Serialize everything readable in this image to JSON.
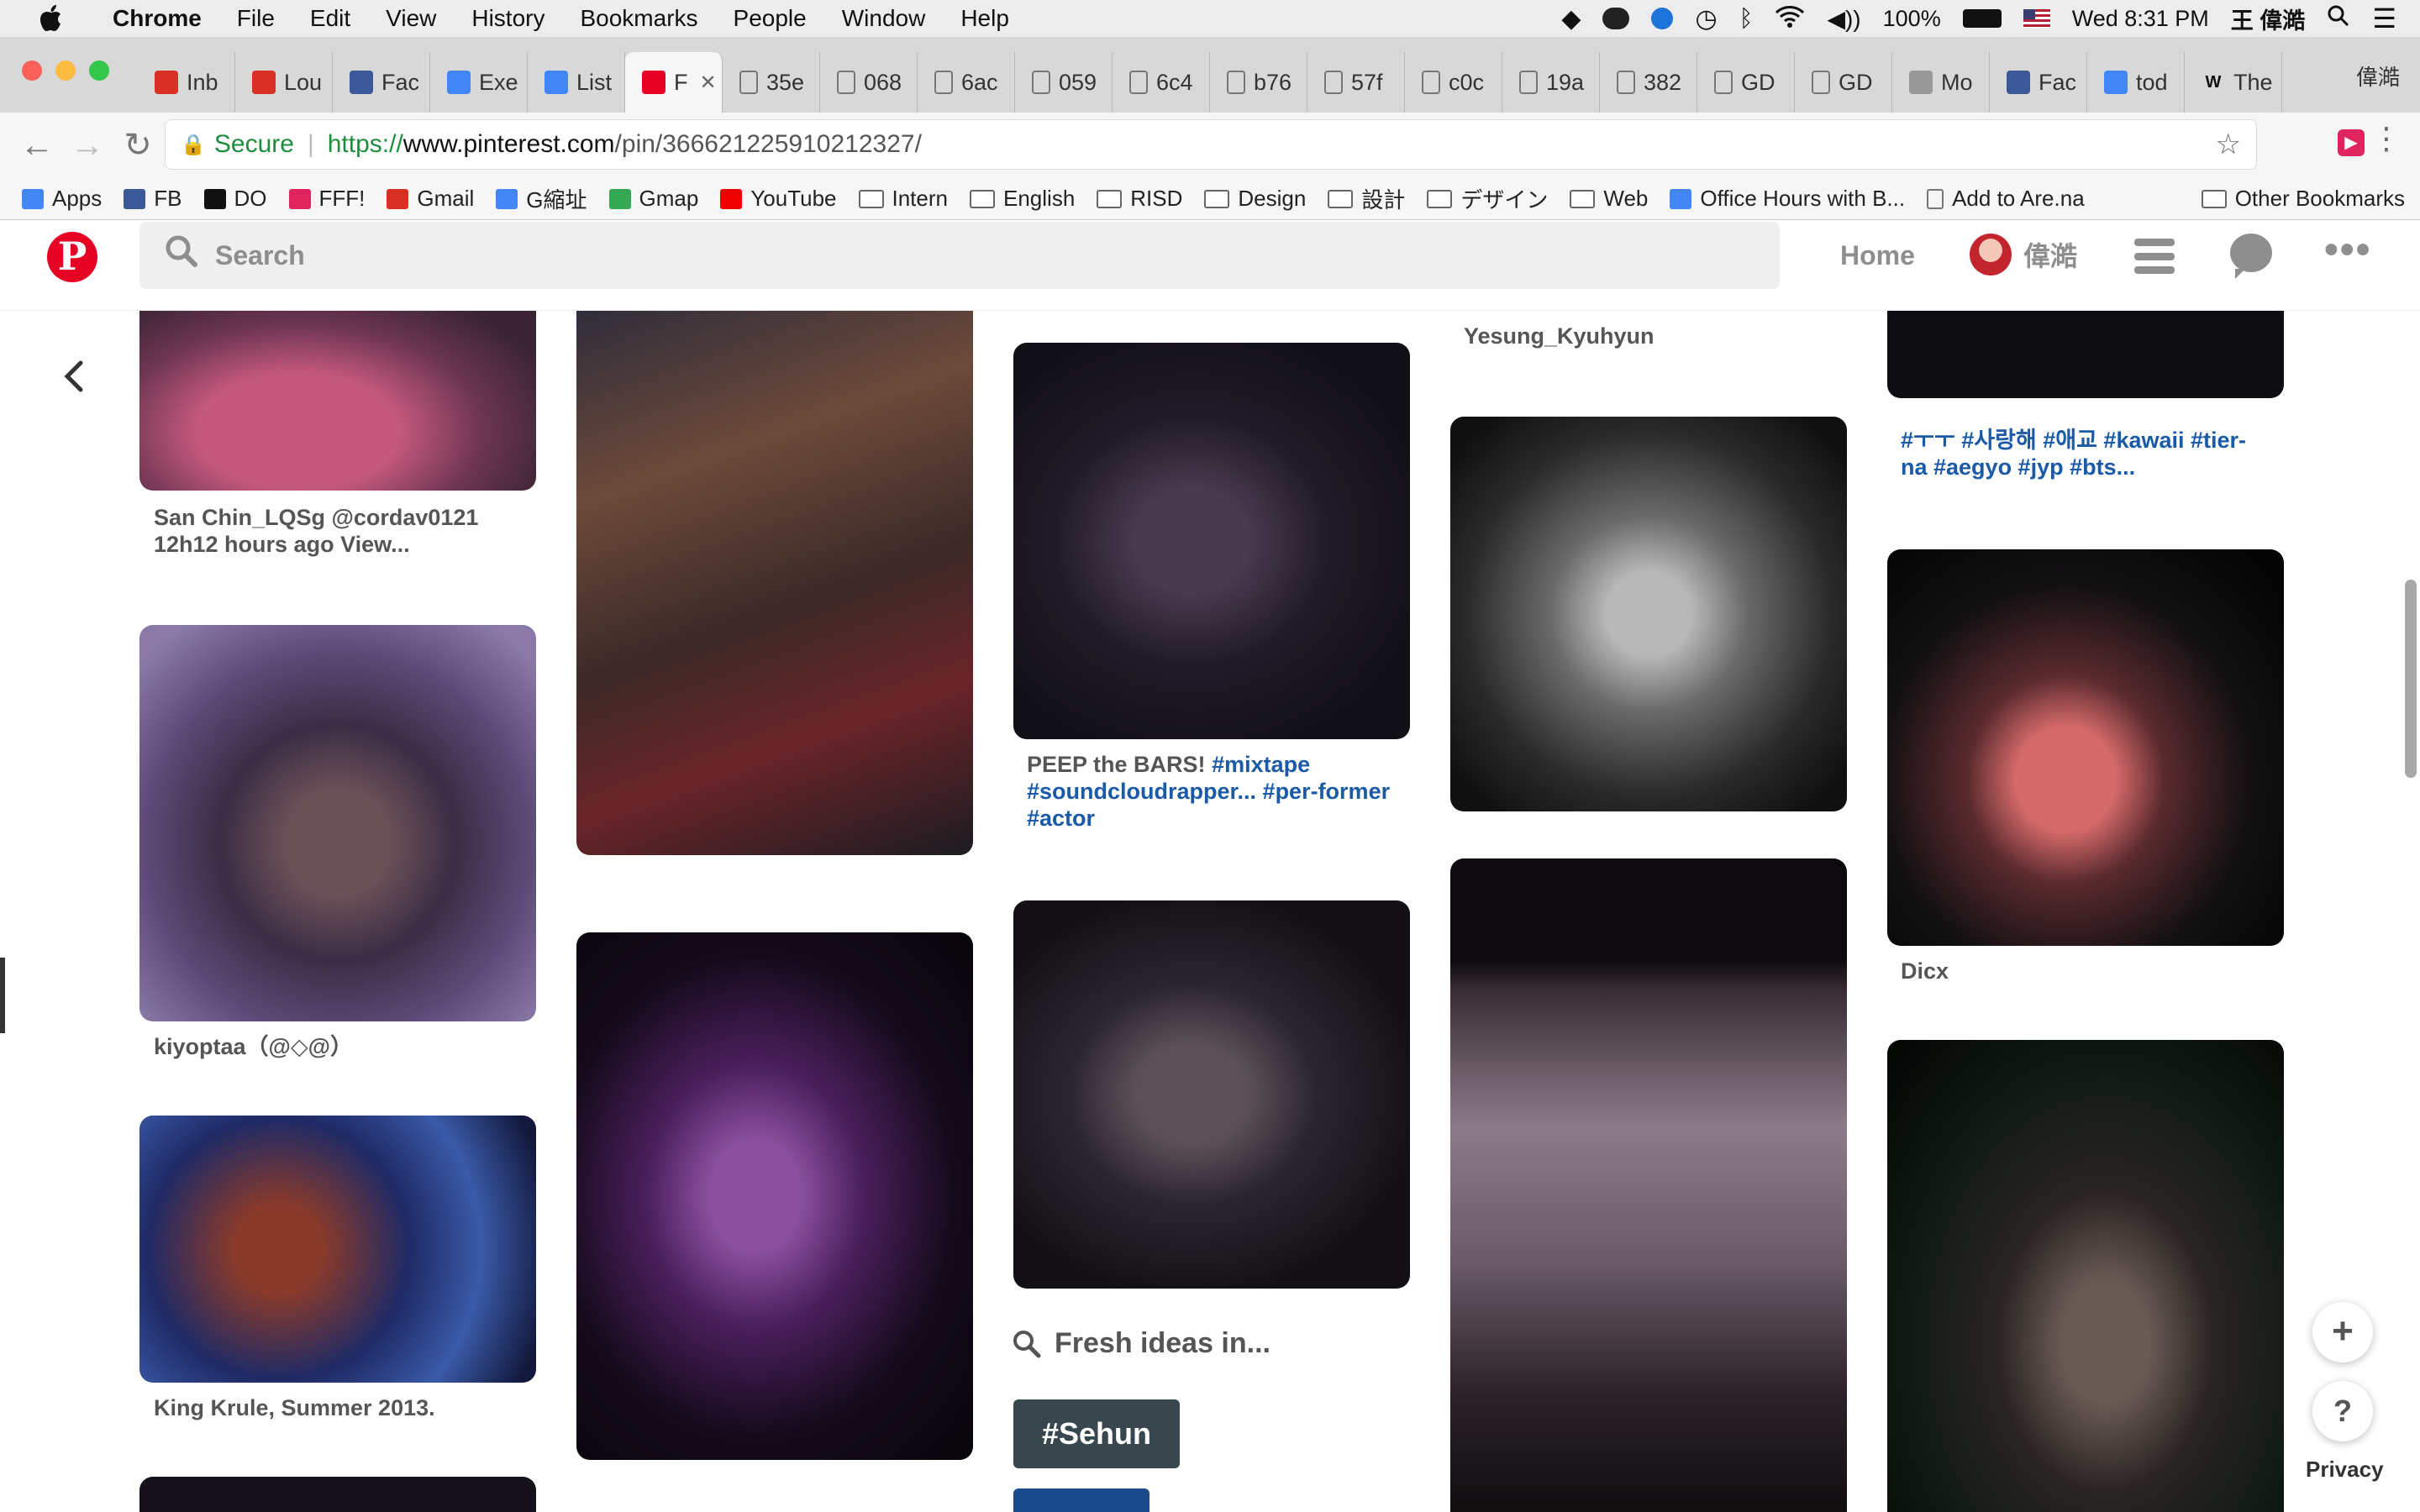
{
  "menubar": {
    "app": "Chrome",
    "items": [
      "File",
      "Edit",
      "View",
      "History",
      "Bookmarks",
      "People",
      "Window",
      "Help"
    ],
    "battery": "100%",
    "datetime": "Wed 8:31 PM",
    "user": "王 偉澔"
  },
  "tabs": [
    {
      "label": "Inb",
      "icon": "gmail-icon",
      "color": "#d93025"
    },
    {
      "label": "Lou",
      "icon": "gmail-icon",
      "color": "#d93025"
    },
    {
      "label": "Fac",
      "icon": "facebook-icon",
      "color": "#3b5998"
    },
    {
      "label": "Exe",
      "icon": "docs-icon",
      "color": "#4285f4"
    },
    {
      "label": "List",
      "icon": "docs-icon",
      "color": "#4285f4"
    },
    {
      "label": "F",
      "icon": "pinterest-icon",
      "color": "#e60023",
      "active": true
    },
    {
      "label": "35e",
      "icon": "file-icon",
      "color": "#888"
    },
    {
      "label": "068",
      "icon": "file-icon",
      "color": "#888"
    },
    {
      "label": "6ac",
      "icon": "file-icon",
      "color": "#888"
    },
    {
      "label": "059",
      "icon": "file-icon",
      "color": "#888"
    },
    {
      "label": "6c4",
      "icon": "file-icon",
      "color": "#888"
    },
    {
      "label": "b76",
      "icon": "file-icon",
      "color": "#888"
    },
    {
      "label": "57f",
      "icon": "file-icon",
      "color": "#888"
    },
    {
      "label": "c0c",
      "icon": "file-icon",
      "color": "#888"
    },
    {
      "label": "19a",
      "icon": "file-icon",
      "color": "#888"
    },
    {
      "label": "382",
      "icon": "file-icon",
      "color": "#888"
    },
    {
      "label": "GD",
      "icon": "file-icon",
      "color": "#888"
    },
    {
      "label": "GD",
      "icon": "file-icon",
      "color": "#888"
    },
    {
      "label": "Mo",
      "icon": "app-icon",
      "color": "#999"
    },
    {
      "label": "Fac",
      "icon": "facebook-icon",
      "color": "#3b5998"
    },
    {
      "label": "tod",
      "icon": "google-icon",
      "color": "#4285f4"
    },
    {
      "label": "The",
      "icon": "wikipedia-icon",
      "color": "#fff"
    }
  ],
  "window_user": "偉澔",
  "address": {
    "secure_label": "Secure",
    "url_scheme": "https://",
    "url_host": "www.pinterest.com",
    "url_path": "/pin/366621225910212327/"
  },
  "bookmarks": [
    {
      "label": "Apps",
      "icon": "apps-icon"
    },
    {
      "label": "FB",
      "icon": "facebook-icon"
    },
    {
      "label": "DO",
      "icon": "do-icon"
    },
    {
      "label": "FFF!",
      "icon": "heart-icon"
    },
    {
      "label": "Gmail",
      "icon": "gmail-icon"
    },
    {
      "label": "G縮址",
      "icon": "google-icon"
    },
    {
      "label": "Gmap",
      "icon": "maps-icon"
    },
    {
      "label": "YouTube",
      "icon": "youtube-icon"
    },
    {
      "label": "Intern",
      "icon": "folder-icon"
    },
    {
      "label": "English",
      "icon": "folder-icon"
    },
    {
      "label": "RISD",
      "icon": "folder-icon"
    },
    {
      "label": "Design",
      "icon": "folder-icon"
    },
    {
      "label": "設計",
      "icon": "folder-icon"
    },
    {
      "label": "デザイン",
      "icon": "folder-icon"
    },
    {
      "label": "Web",
      "icon": "folder-icon"
    },
    {
      "label": "Office Hours with B...",
      "icon": "docs-icon"
    },
    {
      "label": "Add to Are.na",
      "icon": "file-icon"
    }
  ],
  "other_bookmarks": "Other Bookmarks",
  "pinterest": {
    "search_placeholder": "Search",
    "home": "Home",
    "username": "偉澔"
  },
  "captions": {
    "c1": "San Chin_LQSg @cordav0121 12h12 hours ago View...",
    "c2": "kiyoptaa（@◇@）",
    "c3": "King Krule, Summer 2013.",
    "c4_text": "PEEP the BARS! ",
    "c4_tags": "#mixtape #soundcloudrapper... #per-former #actor",
    "c5": "Yesung_Kyuhyun",
    "c6": "#ㅜㅜ #사랑해 #애교 #kawaii #tier-na #aegyo #jyp #bts...",
    "c7": "Dicx"
  },
  "fresh_ideas": "Fresh ideas in...",
  "sehun_tag": "#Sehun",
  "fab": {
    "plus": "+",
    "help": "?",
    "privacy": "Privacy"
  }
}
